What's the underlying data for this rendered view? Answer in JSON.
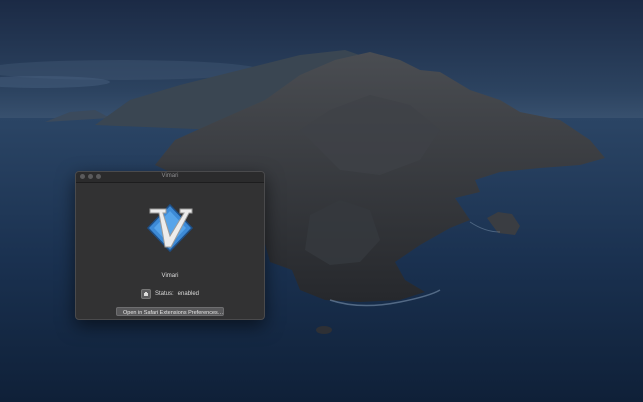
{
  "window": {
    "title": "Vimari",
    "app_name": "Vimari",
    "status_label": "Status:",
    "status_value": "enabled",
    "open_prefs_button_label": "Open in Safari Extensions Preferences…",
    "icons": {
      "logo": "vim-logo-icon",
      "status": "puzzle-piece-icon"
    }
  },
  "colors": {
    "window_bg": "#323233",
    "vim_blue": "#3d8ad6",
    "vim_white": "#ececec"
  }
}
